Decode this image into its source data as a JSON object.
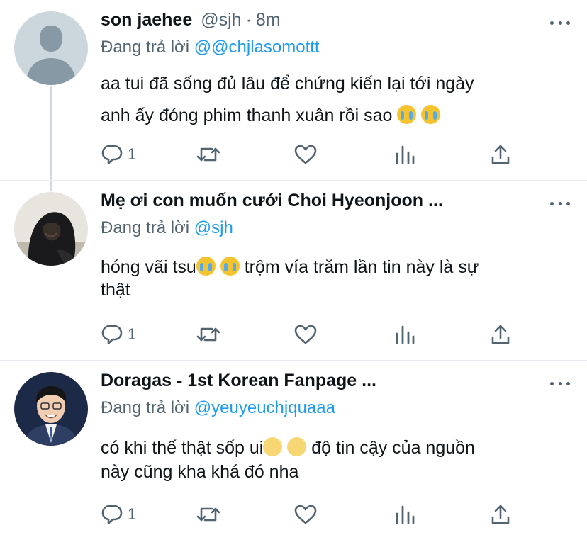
{
  "tweets": [
    {
      "name": "son jaehee",
      "handle": "@sjh",
      "separator": "·",
      "time": "8m",
      "replying_prefix": "Đang trả lời",
      "replying_to": "@@chjlasomottt",
      "text_line1": "aa tui đã sống đủ lâu để chứng kiến lại tới ngày",
      "text_line2": "anh ấy đóng phim thanh xuân rồi sao",
      "emojis": [
        "loudly-crying-face",
        "loudly-crying-face"
      ],
      "reply_count": "1",
      "avatar": "default-avatar"
    },
    {
      "name": "Mẹ ơi con muốn cưới Choi Hyeonjoon ...",
      "replying_prefix": "Đang trả lời",
      "replying_to": "@sjh",
      "text_line1a": "hóng vãi tsu",
      "text_line1b": " trộm vía trăm lần tin này là sự",
      "text_line2": "thật",
      "emojis": [
        "loudly-crying-face",
        "loudly-crying-face"
      ],
      "reply_count": "1",
      "avatar": "hooded-person-photo"
    },
    {
      "name": "Doragas - 1st Korean Fanpage ...",
      "replying_prefix": "Đang trả lời",
      "replying_to": "@yeuyeuchjquaaa",
      "text_line1a": "có khi thế thật sốp ui",
      "text_line1b": " độ tin cậy của nguồn",
      "text_line2": "này cũng kha khá đó nha",
      "emojis": [
        "slightly-smiling-face",
        "slightly-smiling-face"
      ],
      "reply_count": "1",
      "avatar": "smiling-man-photo"
    }
  ],
  "icons": {
    "reply": "reply-icon",
    "retweet": "retweet-icon",
    "like": "heart-icon",
    "analytics": "analytics-icon",
    "share": "share-icon",
    "more": "more-icon"
  },
  "colors": {
    "text": "#0f1419",
    "secondary": "#536471",
    "link": "#1d9bf0",
    "divider": "#e6ecf0",
    "thread_line": "#cfd9de"
  }
}
